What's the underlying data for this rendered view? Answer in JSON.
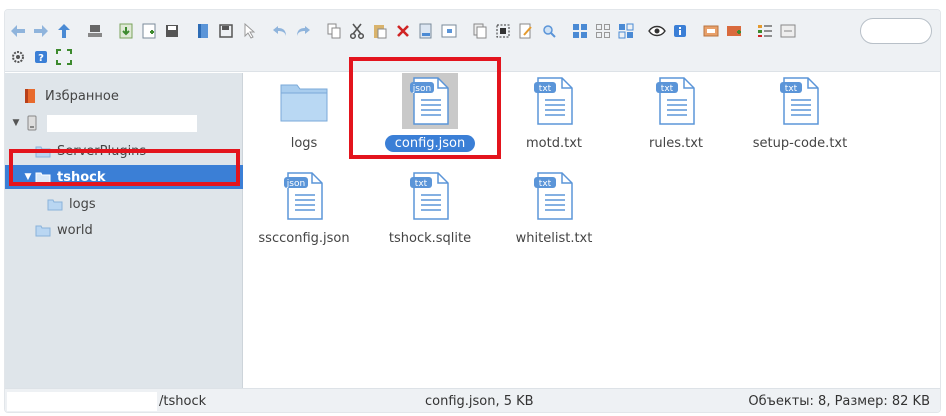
{
  "toolbar": {
    "row1": [
      "back-icon",
      "forward-icon",
      "up-icon",
      "drive-icon",
      "download-icon",
      "new-file-icon",
      "save-icon",
      "open-icon",
      "save-as-icon",
      "select-icon",
      "undo-icon",
      "redo-icon",
      "copy-icon",
      "cut-icon",
      "paste-icon",
      "delete-icon",
      "rename-icon",
      "resize-icon",
      "duplicate-icon",
      "select-all-icon",
      "edit-icon",
      "search-files-icon",
      "icons-view-icon",
      "small-icons-view-icon",
      "list-view-icon",
      "preview-icon",
      "info-icon",
      "extract-icon",
      "archive-icon",
      "sort-icon",
      "resize-image-icon"
    ],
    "row2": [
      "settings-icon",
      "help-icon",
      "fullscreen-icon"
    ],
    "search_placeholder": ""
  },
  "sidebar": {
    "favorites_label": "Избранное",
    "root_label": "",
    "items": [
      {
        "label": "ServerPlugins"
      },
      {
        "label": "tshock"
      },
      {
        "label": "logs"
      },
      {
        "label": "world"
      }
    ]
  },
  "files": [
    {
      "name": "logs",
      "type": "folder"
    },
    {
      "name": "config.json",
      "type": "file",
      "badge": "json"
    },
    {
      "name": "motd.txt",
      "type": "file",
      "badge": "txt"
    },
    {
      "name": "rules.txt",
      "type": "file",
      "badge": "txt"
    },
    {
      "name": "setup-code.txt",
      "type": "file",
      "badge": "txt"
    },
    {
      "name": "sscconfig.json",
      "type": "file",
      "badge": "json"
    },
    {
      "name": "tshock.sqlite",
      "type": "file",
      "badge": "txt"
    },
    {
      "name": "whitelist.txt",
      "type": "file",
      "badge": "txt"
    }
  ],
  "status": {
    "path": "/tshock",
    "selection": "config.json, 5 KB",
    "totals": "Объекты: 8, Размер: 82 KB"
  },
  "colors": {
    "accent": "#3b7fd6",
    "annotation": "#e3141d",
    "folder": "#a9cdee",
    "file_badge": "#5b95d8"
  }
}
